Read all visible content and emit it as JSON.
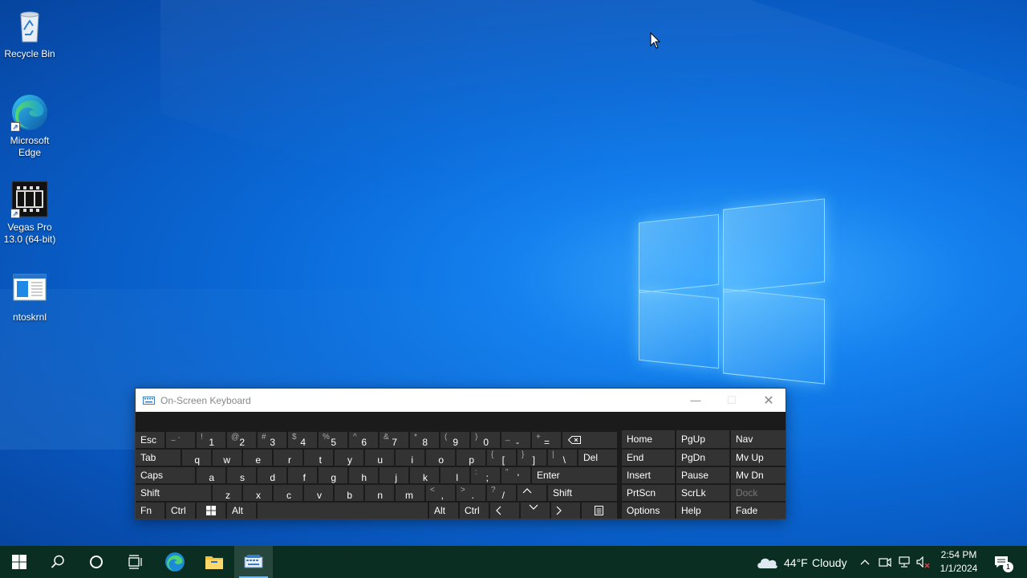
{
  "desktop": {
    "icons": [
      {
        "label": "Recycle Bin"
      },
      {
        "label": "Microsoft Edge"
      },
      {
        "label": "Vegas Pro 13.0 (64-bit)"
      },
      {
        "label": "ntoskrnl"
      }
    ]
  },
  "osk": {
    "title": "On-Screen Keyboard",
    "row1": {
      "esc": "Esc",
      "k1": [
        "~ `",
        ""
      ],
      "k2": [
        "!",
        "1"
      ],
      "k3": [
        "@",
        "2"
      ],
      "k4": [
        "#",
        "3"
      ],
      "k5": [
        "$",
        "4"
      ],
      "k6": [
        "%",
        "5"
      ],
      "k7": [
        "^",
        "6"
      ],
      "k8": [
        "&",
        "7"
      ],
      "k9": [
        "*",
        "8"
      ],
      "k10": [
        "(",
        "9"
      ],
      "k11": [
        ")",
        "0"
      ],
      "k12": [
        "_",
        "-"
      ],
      "k13": [
        "+",
        "="
      ]
    },
    "row2": {
      "tab": "Tab",
      "letters": [
        "q",
        "w",
        "e",
        "r",
        "t",
        "y",
        "u",
        "i",
        "o",
        "p"
      ],
      "lbrace": [
        "{",
        "["
      ],
      "rbrace": [
        "}",
        "]"
      ],
      "pipe": [
        "|",
        "\\"
      ],
      "del": "Del"
    },
    "row3": {
      "caps": "Caps",
      "letters": [
        "a",
        "s",
        "d",
        "f",
        "g",
        "h",
        "j",
        "k",
        "l"
      ],
      "colon": [
        ":",
        ";"
      ],
      "quote": [
        "\"",
        "'"
      ],
      "enter": "Enter"
    },
    "row4": {
      "shift_l": "Shift",
      "letters": [
        "z",
        "x",
        "c",
        "v",
        "b",
        "n",
        "m"
      ],
      "lt": [
        "<",
        ","
      ],
      "gt": [
        ">",
        "."
      ],
      "q": [
        "?",
        "/"
      ],
      "shift_r": "Shift"
    },
    "row5": {
      "fn": "Fn",
      "ctrl_l": "Ctrl",
      "alt_l": "Alt",
      "alt_r": "Alt",
      "ctrl_r": "Ctrl"
    },
    "nav": [
      [
        "Home",
        "PgUp",
        "Nav"
      ],
      [
        "End",
        "PgDn",
        "Mv Up"
      ],
      [
        "Insert",
        "Pause",
        "Mv Dn"
      ],
      [
        "PrtScn",
        "ScrLk",
        "Dock"
      ],
      [
        "Options",
        "Help",
        "Fade"
      ]
    ]
  },
  "taskbar": {
    "weather_temp": "44°F",
    "weather_desc": "Cloudy",
    "time": "2:54 PM",
    "date": "1/1/2024",
    "notification_count": "1"
  }
}
